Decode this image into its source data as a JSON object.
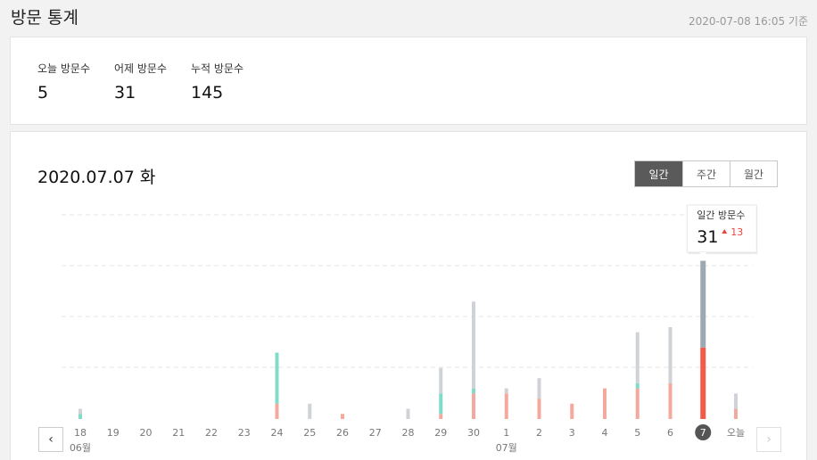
{
  "header": {
    "title": "방문 통계",
    "timestamp": "2020-07-08 16:05 기준"
  },
  "summary": [
    {
      "label": "오늘 방문수",
      "value": "5"
    },
    {
      "label": "어제 방문수",
      "value": "31"
    },
    {
      "label": "누적 방문수",
      "value": "145"
    }
  ],
  "chart_header": {
    "date": "2020.07.07 화",
    "tabs": [
      {
        "label": "일간",
        "active": true
      },
      {
        "label": "주간",
        "active": false
      },
      {
        "label": "월간",
        "active": false
      }
    ]
  },
  "tooltip": {
    "title": "일간 방문수",
    "value": "31",
    "delta": "13",
    "delta_color": "#e8453c"
  },
  "nav": {
    "prev_icon": "chevron-left-icon",
    "next_icon": "chevron-right-icon"
  },
  "colors": {
    "red": "#f4a99e",
    "red_selected": "#f25b4a",
    "teal": "#7fdcc9",
    "gray": "#cfd2d6",
    "gray_selected": "#9ea8b0"
  },
  "chart_data": {
    "type": "bar",
    "categories": [
      "18",
      "19",
      "20",
      "21",
      "22",
      "23",
      "24",
      "25",
      "26",
      "27",
      "28",
      "29",
      "30",
      "1",
      "2",
      "3",
      "4",
      "5",
      "6",
      "7",
      "오늘"
    ],
    "month_labels": [
      {
        "index": 0,
        "label": "06월"
      },
      {
        "index": 13,
        "label": "07월"
      }
    ],
    "selected_index": 19,
    "series": [
      {
        "color": "red",
        "values": [
          0,
          0,
          0,
          0,
          0,
          0,
          3,
          0,
          1,
          0,
          0,
          1,
          5,
          5,
          4,
          3,
          6,
          6,
          7,
          14,
          2
        ]
      },
      {
        "color": "teal",
        "values": [
          1,
          0,
          0,
          0,
          0,
          0,
          10,
          0,
          0,
          0,
          0,
          4,
          1,
          0,
          0,
          0,
          0,
          1,
          0,
          0,
          0
        ]
      },
      {
        "color": "gray",
        "values": [
          1,
          0,
          0,
          0,
          0,
          0,
          0,
          3,
          0,
          0,
          2,
          5,
          17,
          1,
          4,
          0,
          0,
          10,
          11,
          17,
          3
        ]
      }
    ],
    "ylim": [
      0,
      40
    ],
    "grid": true
  }
}
